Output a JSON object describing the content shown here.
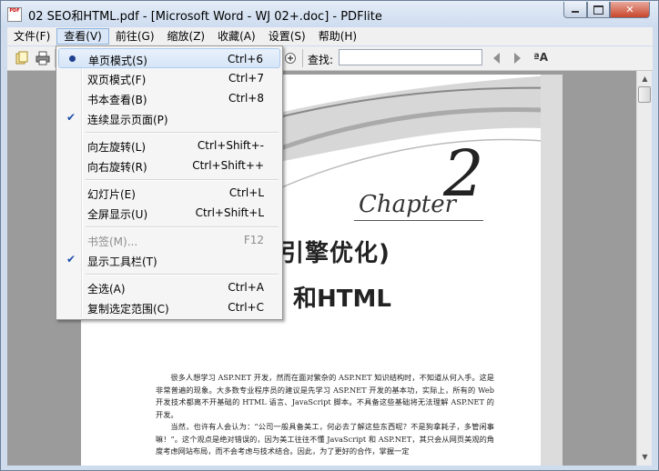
{
  "window": {
    "title": "02 SEO和HTML.pdf - [Microsoft Word - WJ 02+.doc] - PDFlite",
    "icon_text": "PDF",
    "controls": [
      "minimize-icon",
      "maximize-icon",
      "close-icon"
    ],
    "close_glyph": "✕"
  },
  "menubar": {
    "items": [
      {
        "label": "文件(F)"
      },
      {
        "label": "查看(V)",
        "active": true
      },
      {
        "label": "前往(G)"
      },
      {
        "label": "缩放(Z)"
      },
      {
        "label": "收藏(A)"
      },
      {
        "label": "设置(S)"
      },
      {
        "label": "帮助(H)"
      }
    ]
  },
  "toolbar": {
    "find_label": "查找:",
    "find_value": "",
    "icons": [
      "open-icon",
      "print-icon",
      "zoom-in-icon",
      "find-prev-icon",
      "find-next-icon",
      "font-size-icon"
    ],
    "aa_label": "ªA"
  },
  "view_menu": {
    "items": [
      {
        "label": "单页模式(S)",
        "shortcut": "Ctrl+6",
        "mark": "dot",
        "highlighted": true
      },
      {
        "label": "双页模式(F)",
        "shortcut": "Ctrl+7"
      },
      {
        "label": "书本查看(B)",
        "shortcut": "Ctrl+8"
      },
      {
        "label": "连续显示页面(P)",
        "shortcut": "",
        "mark": "check"
      },
      {
        "separator": true
      },
      {
        "label": "向左旋转(L)",
        "shortcut": "Ctrl+Shift+-"
      },
      {
        "label": "向右旋转(R)",
        "shortcut": "Ctrl+Shift++"
      },
      {
        "separator": true
      },
      {
        "label": "幻灯片(E)",
        "shortcut": "Ctrl+L"
      },
      {
        "label": "全屏显示(U)",
        "shortcut": "Ctrl+Shift+L"
      },
      {
        "separator": true
      },
      {
        "label": "书签(M)...",
        "shortcut": "F12",
        "disabled": true
      },
      {
        "label": "显示工具栏(T)",
        "shortcut": "",
        "mark": "check"
      },
      {
        "separator": true
      },
      {
        "label": "全选(A)",
        "shortcut": "Ctrl+A"
      },
      {
        "label": "复制选定范围(C)",
        "shortcut": "Ctrl+C"
      }
    ]
  },
  "document": {
    "chapter_word": "Chapter",
    "chapter_number": "2",
    "heading_line1": "引擎优化)",
    "heading_line2": "和HTML",
    "paragraphs": [
      "很多人想学习 ASP.NET 开发，然而在面对繁杂的 ASP.NET 知识结构时，不知道从何入手。这是非常普遍的现象。大多数专业程序员的建议是先学习 ASP.NET 开发的基本功，实际上，所有的 Web 开发技术都离不开基础的 HTML 语言、JavaScript 脚本。不具备这些基础将无法理解 ASP.NET 的开发。",
      "当然，也许有人会认为：“公司一般具备美工，何必去了解这些东西呢？不是狗拿耗子，多管闲事嘛！”。这个观点是绝对错误的，因为美工往往不懂 JavaScript 和 ASP.NET，其只会从网页美观的角度考虑网站布局，而不会考虑与技术结合。因此，为了更好的合作，掌握一定"
    ]
  }
}
